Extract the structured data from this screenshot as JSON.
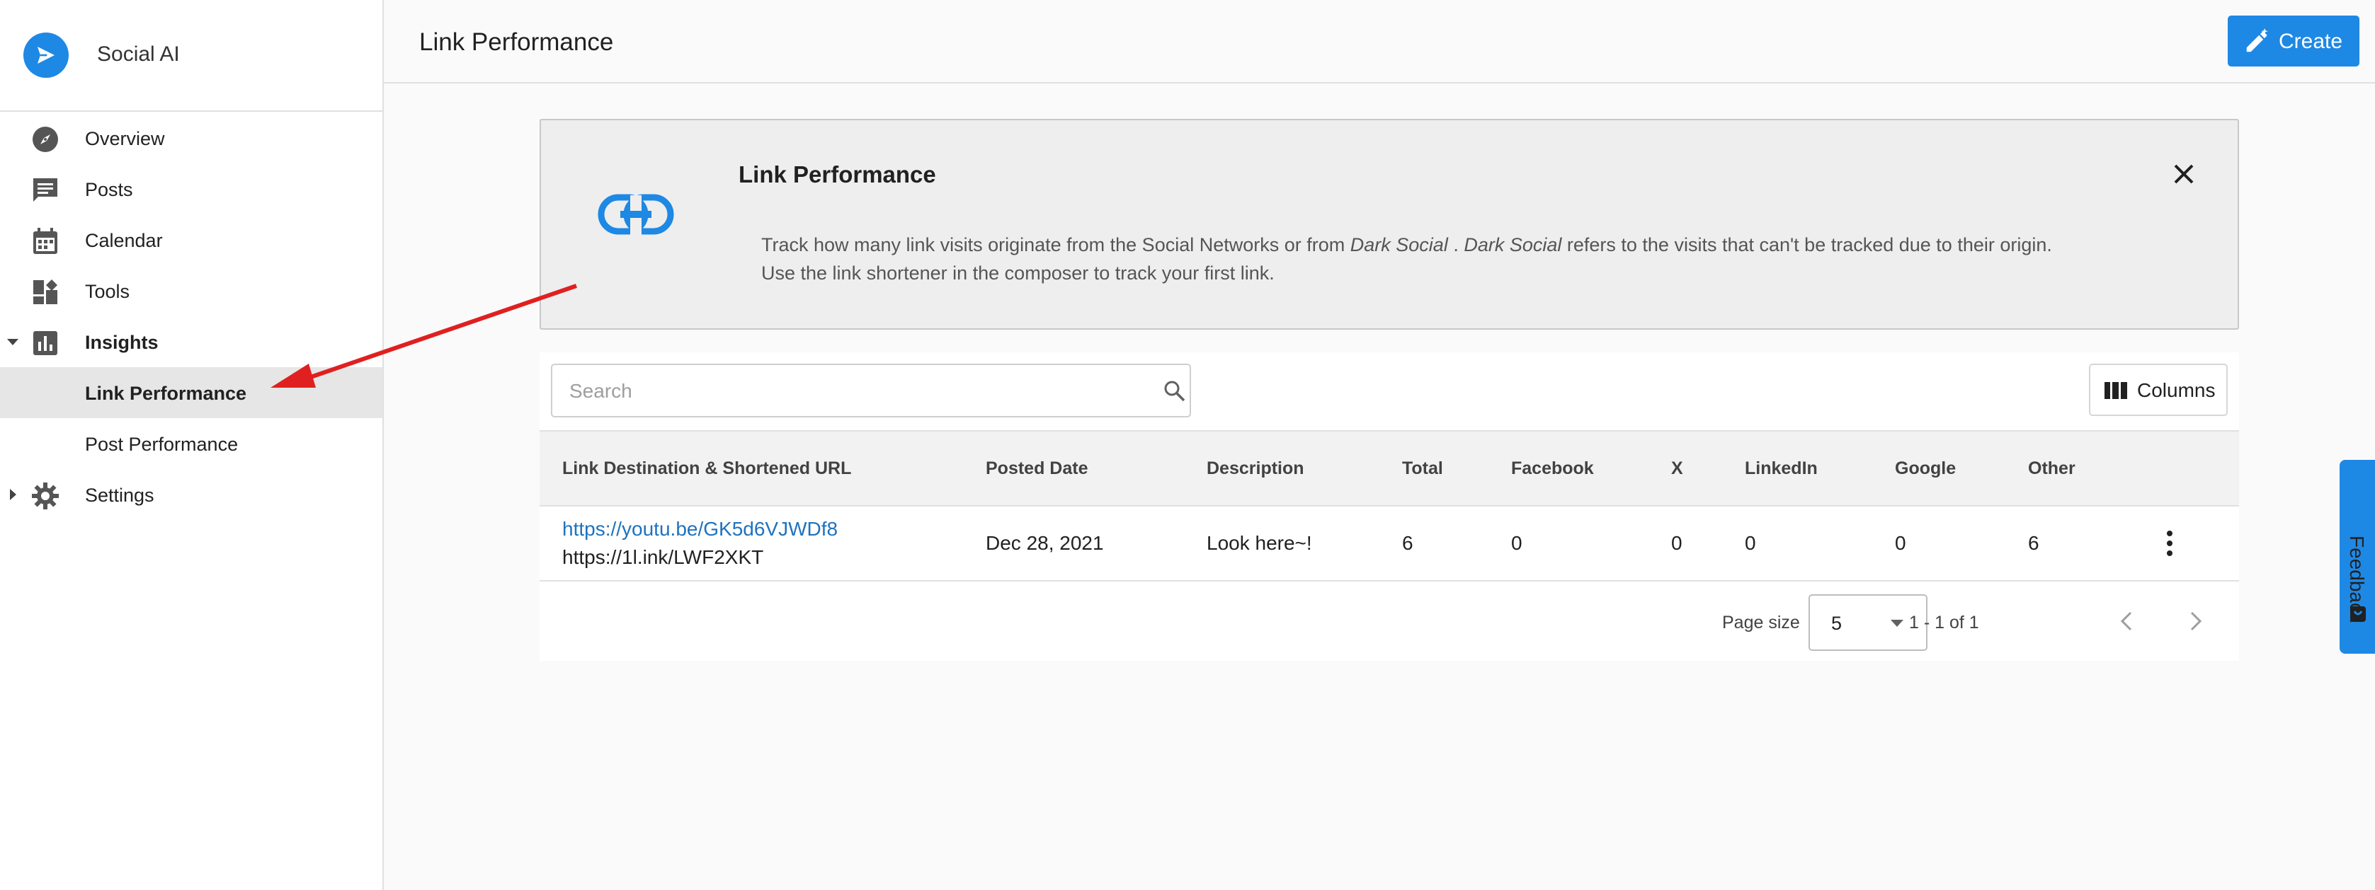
{
  "brand": {
    "name": "Social AI",
    "color": "#1e88e5"
  },
  "sidebar": {
    "items": [
      {
        "label": "Overview",
        "icon": "compass-icon"
      },
      {
        "label": "Posts",
        "icon": "chat-bubble-icon"
      },
      {
        "label": "Calendar",
        "icon": "calendar-icon"
      },
      {
        "label": "Tools",
        "icon": "dashboard-tools-icon"
      },
      {
        "label": "Insights",
        "icon": "bar-chart-icon",
        "expanded": true
      },
      {
        "label": "Link Performance",
        "active": true
      },
      {
        "label": "Post Performance"
      },
      {
        "label": "Settings",
        "icon": "gear-icon",
        "expanded": false
      }
    ]
  },
  "header": {
    "title": "Link Performance",
    "create_label": "Create"
  },
  "banner": {
    "title": "Link Performance",
    "text_before": "Track how many link visits originate from the Social Networks or from ",
    "dark_social_1": "Dark Social",
    "text_middle": " . ",
    "dark_social_2": "Dark Social",
    "text_after": " refers to the visits that can't be tracked due to their origin.",
    "line2": "Use the link shortener in the composer to track your first link."
  },
  "search": {
    "placeholder": "Search",
    "value": ""
  },
  "columns_button": {
    "label": "Columns"
  },
  "table": {
    "headers": [
      "Link Destination & Shortened URL",
      "Posted Date",
      "Description",
      "Total",
      "Facebook",
      "X",
      "LinkedIn",
      "Google",
      "Other"
    ],
    "rows": [
      {
        "destination": "https://youtu.be/GK5d6VJWDf8",
        "short_url": "https://1l.ink/LWF2XKT",
        "posted_date": "Dec 28, 2021",
        "description": "Look here~!",
        "total": "6",
        "facebook": "0",
        "x": "0",
        "linkedin": "0",
        "google": "0",
        "other": "6"
      }
    ]
  },
  "pager": {
    "page_size_label": "Page size",
    "page_size": "5",
    "range": "1 - 1 of 1"
  },
  "feedback": {
    "label": "Feedback"
  },
  "colors": {
    "accent": "#1e88e5",
    "link": "#1e73be",
    "annotation_arrow": "#e02020"
  }
}
